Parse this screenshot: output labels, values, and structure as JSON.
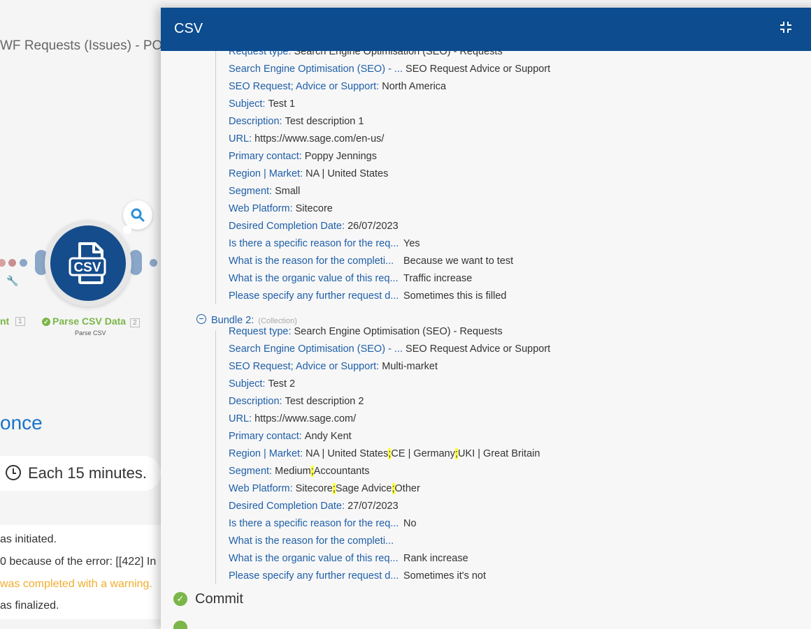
{
  "background": {
    "scenario_title": "WF Requests (Issues) - POPPY",
    "module": {
      "icon_text": "CSV",
      "label": "Parse CSV Data",
      "number": "2",
      "sublabel": "Parse CSV"
    },
    "prev_module": {
      "label_fragment": "nt",
      "number": "1"
    },
    "run_label": "once",
    "schedule": "Each 15 minutes.",
    "log": [
      {
        "text": "as initiated.",
        "status": "normal"
      },
      {
        "text": "0 because of the error: [[422] In",
        "status": "normal"
      },
      {
        "text": "was completed with a warning.",
        "status": "warning"
      },
      {
        "text": "as finalized.",
        "status": "normal"
      }
    ]
  },
  "panel": {
    "title": "CSV",
    "collapse_icon": "collapse-icon",
    "bundle1_rows": [
      {
        "key": "Request type:",
        "value": "Search Engine Optimisation (SEO) - Requests",
        "fixed": false
      },
      {
        "key": "Search Engine Optimisation (SEO) - ...",
        "value": "SEO Request Advice or Support",
        "fixed": false
      },
      {
        "key": "SEO Request; Advice or Support:",
        "value": "North America",
        "fixed": false
      },
      {
        "key": "Subject:",
        "value": "Test 1",
        "fixed": false
      },
      {
        "key": "Description:",
        "value": "Test description 1",
        "fixed": false
      },
      {
        "key": "URL:",
        "value": "https://www.sage.com/en-us/",
        "fixed": false
      },
      {
        "key": "Primary contact:",
        "value": "Poppy Jennings",
        "fixed": false
      },
      {
        "key": "Region | Market:",
        "value": "NA | United States",
        "fixed": false
      },
      {
        "key": "Segment:",
        "value": "Small",
        "fixed": false
      },
      {
        "key": "Web Platform:",
        "value": "Sitecore",
        "fixed": false
      },
      {
        "key": "Desired Completion Date:",
        "value": "26/07/2023",
        "fixed": false
      },
      {
        "key": "Is there a specific reason for the req...",
        "value": "Yes",
        "fixed": true
      },
      {
        "key": "What is the reason for the completi...",
        "value": "Because we want to test",
        "fixed": true
      },
      {
        "key": "What is the organic value of this req...",
        "value": "Traffic increase",
        "fixed": true
      },
      {
        "key": "Please specify any further request d...",
        "value": "Sometimes this is filled",
        "fixed": true
      }
    ],
    "bundle2": {
      "label": "Bundle 2:",
      "type": "(Collection)"
    },
    "bundle2_rows": [
      {
        "key": "Request type:",
        "value": "Search Engine Optimisation (SEO) - Requests",
        "fixed": false
      },
      {
        "key": "Search Engine Optimisation (SEO) - ...",
        "value": "SEO Request Advice or Support",
        "fixed": false
      },
      {
        "key": "SEO Request; Advice or Support:",
        "value": "Multi-market",
        "fixed": false
      },
      {
        "key": "Subject:",
        "value": "Test 2",
        "fixed": false
      },
      {
        "key": "Description:",
        "value": "Test description 2",
        "fixed": false
      },
      {
        "key": "URL:",
        "value": "https://www.sage.com/",
        "fixed": false
      },
      {
        "key": "Primary contact:",
        "value": "Andy Kent",
        "fixed": false
      },
      {
        "key": "Region | Market:",
        "value": [
          "NA | United States",
          ";",
          "CE | Germany",
          ";",
          "UKI | Great Britain"
        ],
        "fixed": false
      },
      {
        "key": "Segment:",
        "value": [
          "Medium",
          ";",
          "Accountants"
        ],
        "fixed": false
      },
      {
        "key": "Web Platform:",
        "value": [
          "Sitecore",
          ";",
          "Sage Advice",
          ";",
          "Other"
        ],
        "fixed": false
      },
      {
        "key": "Desired Completion Date:",
        "value": "27/07/2023",
        "fixed": false
      },
      {
        "key": "Is there a specific reason for the req...",
        "value": "No",
        "fixed": true
      },
      {
        "key": "What is the reason for the completi...",
        "value": "",
        "fixed": true
      },
      {
        "key": "What is the organic value of this req...",
        "value": "Rank increase",
        "fixed": true
      },
      {
        "key": "Please specify any further request d...",
        "value": "Sometimes it's not",
        "fixed": true
      }
    ],
    "commit_label": "Commit",
    "colors": {
      "header": "#0c4c8f",
      "key": "#1f5fa8",
      "highlight": "#ffff33",
      "success": "#7ab648",
      "warning": "#f0ad2e"
    }
  }
}
